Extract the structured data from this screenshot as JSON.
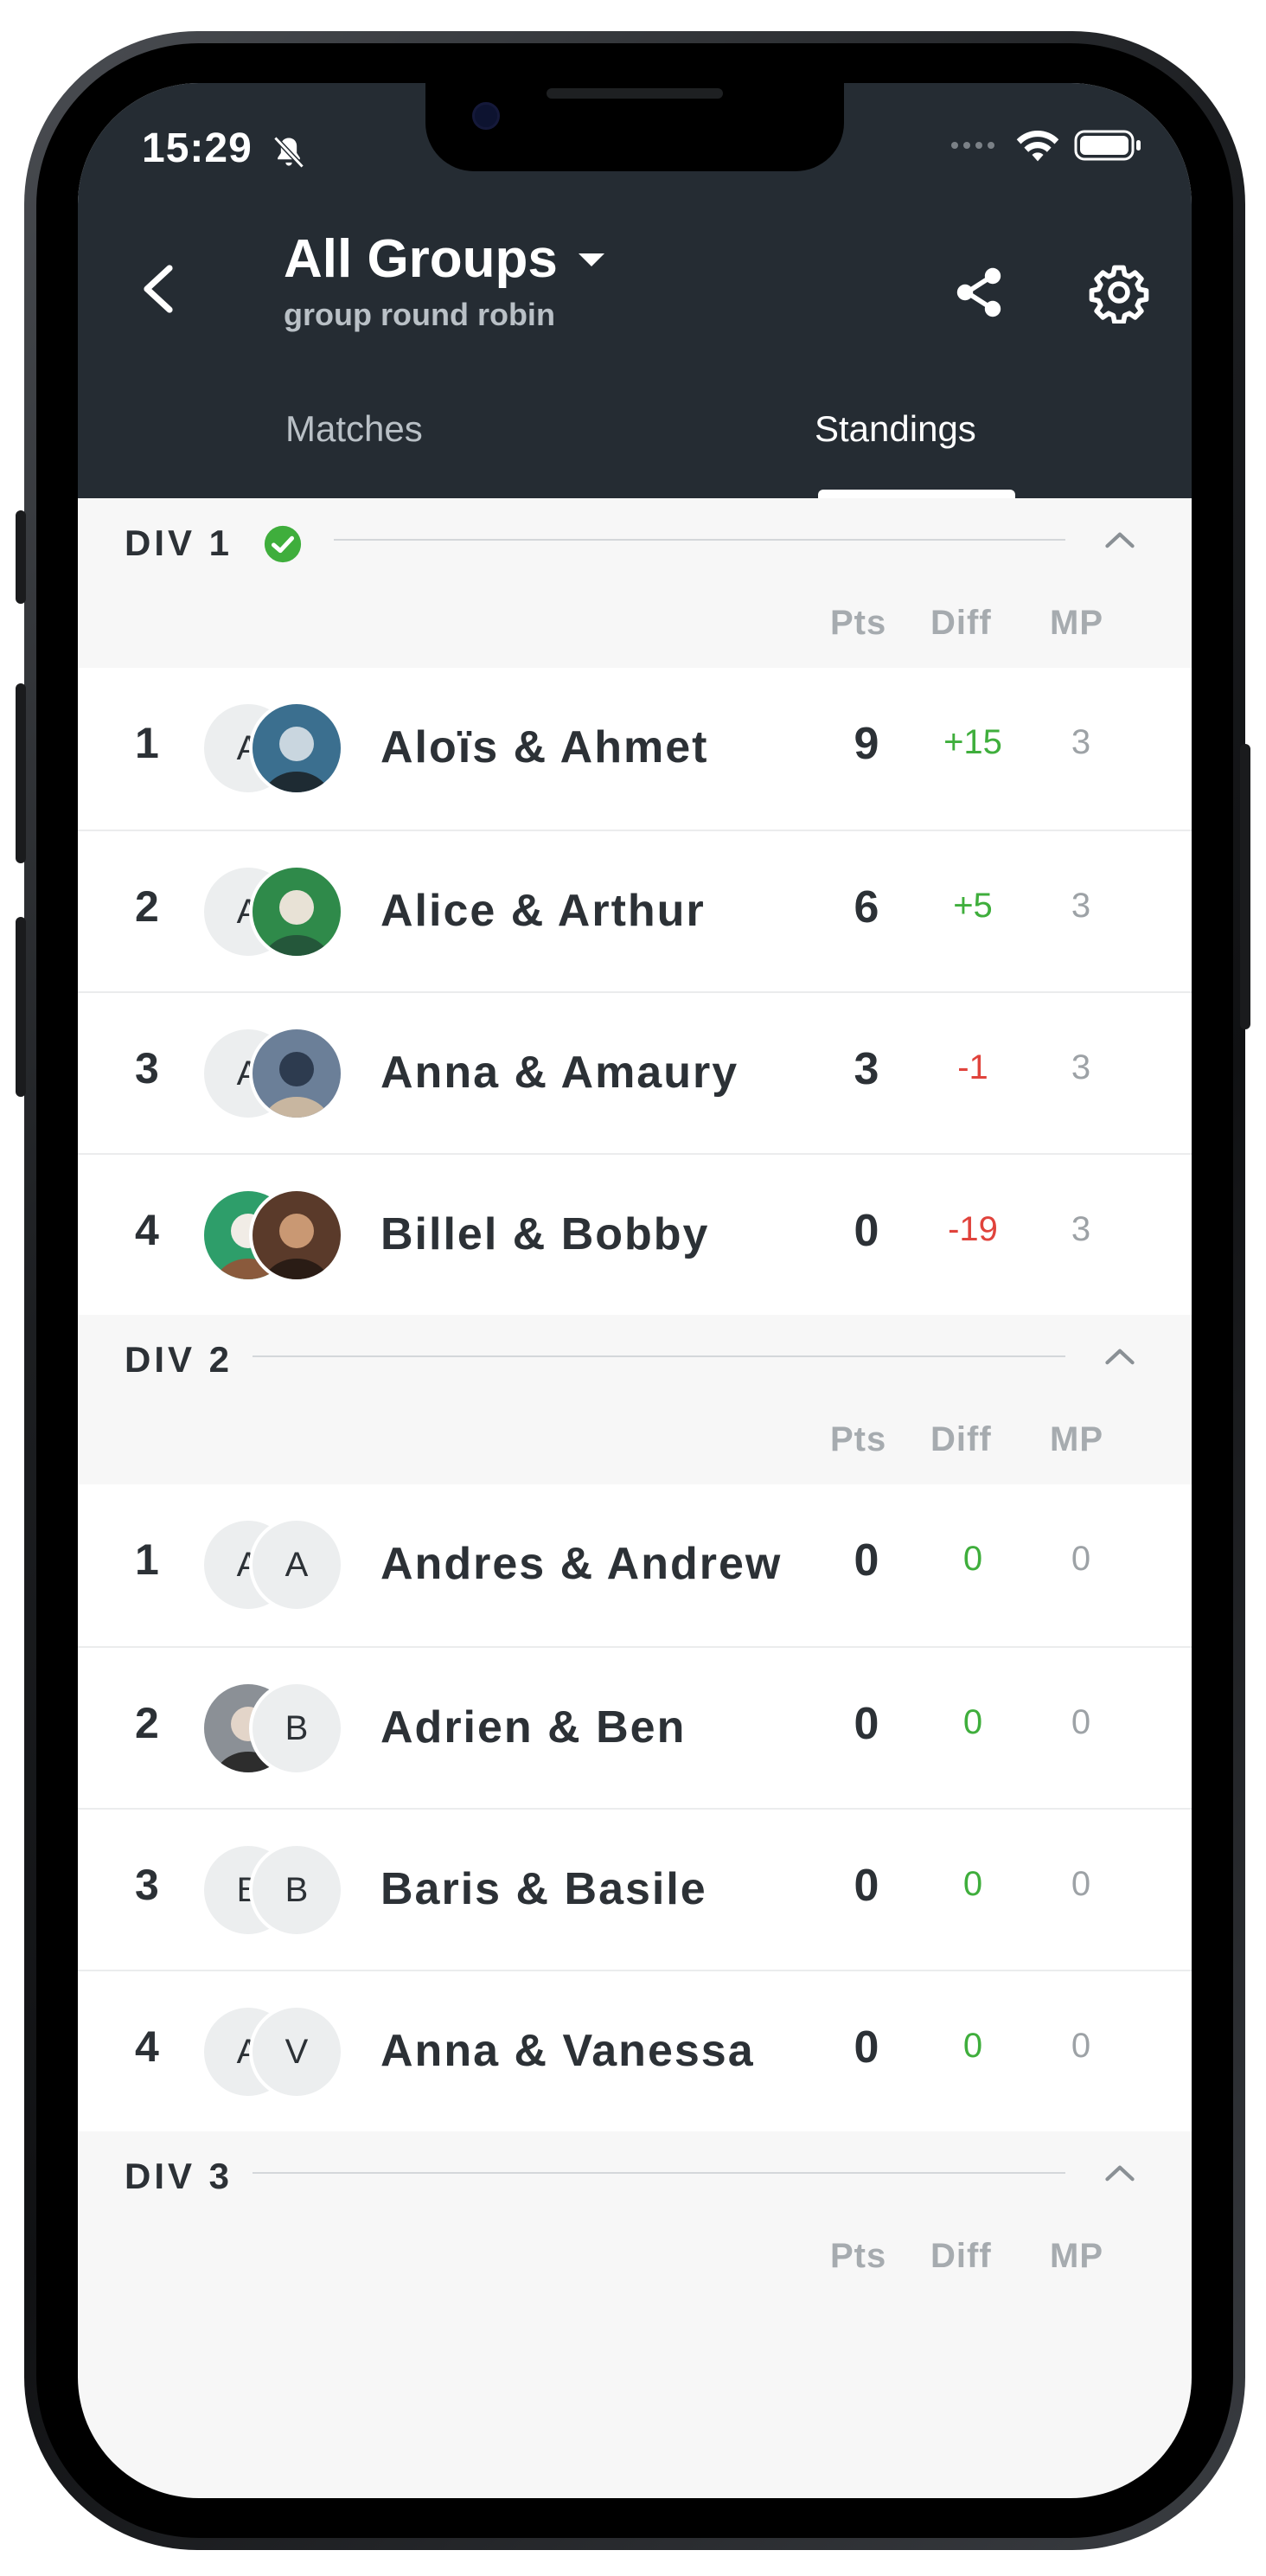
{
  "status_bar": {
    "time": "15:29"
  },
  "header": {
    "title": "All Groups",
    "subtitle": "group round robin",
    "tabs": [
      {
        "label": "Matches",
        "active": false
      },
      {
        "label": "Standings",
        "active": true
      }
    ]
  },
  "columns": {
    "pts": "Pts",
    "diff": "Diff",
    "mp": "MP"
  },
  "colors": {
    "header_bg": "#252c33",
    "positive": "#3fae3c",
    "negative": "#e0433c",
    "check": "#3fae3c"
  },
  "divisions": [
    {
      "name": "DIV 1",
      "completed": true,
      "rows": [
        {
          "rank": "1",
          "team": "Aloïs & Ahmet",
          "pts": "9",
          "diff": "+15",
          "mp": "3",
          "avatar1": "A",
          "avatar2": "photo"
        },
        {
          "rank": "2",
          "team": "Alice & Arthur",
          "pts": "6",
          "diff": "+5",
          "mp": "3",
          "avatar1": "A",
          "avatar2": "photo"
        },
        {
          "rank": "3",
          "team": "Anna & Amaury",
          "pts": "3",
          "diff": "-1",
          "mp": "3",
          "avatar1": "A",
          "avatar2": "photo"
        },
        {
          "rank": "4",
          "team": "Billel & Bobby",
          "pts": "0",
          "diff": "-19",
          "mp": "3",
          "avatar1": "photo",
          "avatar2": "photo"
        }
      ]
    },
    {
      "name": "DIV 2",
      "completed": false,
      "rows": [
        {
          "rank": "1",
          "team": "Andres & Andrew",
          "pts": "0",
          "diff": "0",
          "mp": "0",
          "avatar1": "A",
          "avatar2": "A"
        },
        {
          "rank": "2",
          "team": "Adrien & Ben",
          "pts": "0",
          "diff": "0",
          "mp": "0",
          "avatar1": "photo",
          "avatar2": "B"
        },
        {
          "rank": "3",
          "team": "Baris & Basile",
          "pts": "0",
          "diff": "0",
          "mp": "0",
          "avatar1": "B",
          "avatar2": "B"
        },
        {
          "rank": "4",
          "team": "Anna & Vanessa",
          "pts": "0",
          "diff": "0",
          "mp": "0",
          "avatar1": "A",
          "avatar2": "V"
        }
      ]
    },
    {
      "name": "DIV 3",
      "completed": false,
      "rows": []
    }
  ]
}
